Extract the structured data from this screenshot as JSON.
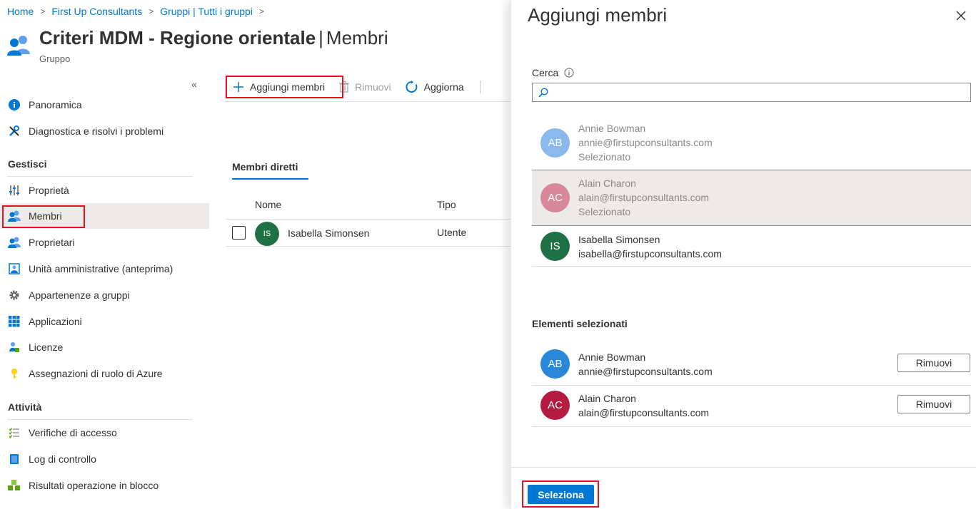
{
  "breadcrumb": [
    "Home",
    "First Up Consultants",
    "Gruppi | Tutti i gruppi"
  ],
  "header": {
    "title_main": "Criteri MDM - Regione orientale",
    "title_sep": "|",
    "title_section": "Membri",
    "subtitle": "Gruppo"
  },
  "sidebar": {
    "collapse_glyph": "«",
    "top_items": [
      {
        "label": "Panoramica",
        "icon": "info-icon"
      },
      {
        "label": "Diagnostica e risolvi i problemi",
        "icon": "wrench-icon"
      }
    ],
    "section_manage": "Gestisci",
    "manage_items": [
      {
        "label": "Proprietà",
        "icon": "sliders-icon"
      },
      {
        "label": "Membri",
        "icon": "users-icon",
        "active": true
      },
      {
        "label": "Proprietari",
        "icon": "users-icon"
      },
      {
        "label": "Unità amministrative (anteprima)",
        "icon": "admin-unit-icon"
      },
      {
        "label": "Appartenenze a gruppi",
        "icon": "gear-icon"
      },
      {
        "label": "Applicazioni",
        "icon": "grid-icon"
      },
      {
        "label": "Licenze",
        "icon": "license-icon"
      },
      {
        "label": "Assegnazioni di ruolo di Azure",
        "icon": "key-icon"
      }
    ],
    "section_activity": "Attività",
    "activity_items": [
      {
        "label": "Verifiche di accesso",
        "icon": "checklist-icon"
      },
      {
        "label": "Log di controllo",
        "icon": "book-icon"
      },
      {
        "label": "Risultati operazione in blocco",
        "icon": "cubes-icon"
      }
    ]
  },
  "toolbar": {
    "add_label": "Aggiungi membri",
    "remove_label": "Rimuovi",
    "refresh_label": "Aggiorna"
  },
  "members": {
    "tab_label": "Membri diretti",
    "columns": [
      "Nome",
      "Tipo"
    ],
    "rows": [
      {
        "initials": "IS",
        "name": "Isabella Simonsen",
        "type": "Utente"
      }
    ]
  },
  "panel": {
    "title": "Aggiungi membri",
    "search_label": "Cerca",
    "search_placeholder": "",
    "results": [
      {
        "initials": "AB",
        "name": "Annie Bowman",
        "email": "annie@firstupconsultants.com",
        "status": "Selezionato",
        "color": "#8ab8ec"
      },
      {
        "initials": "AC",
        "name": "Alain Charon",
        "email": "alain@firstupconsultants.com",
        "status": "Selezionato",
        "color": "#d9879a"
      },
      {
        "initials": "IS",
        "name": "Isabella Simonsen",
        "email": "isabella@firstupconsultants.com",
        "color": "#1e7145"
      }
    ],
    "selected_heading": "Elementi selezionati",
    "selected": [
      {
        "initials": "AB",
        "name": "Annie Bowman",
        "email": "annie@firstupconsultants.com",
        "remove_label": "Rimuovi",
        "color": "#2b88d8"
      },
      {
        "initials": "AC",
        "name": "Alain Charon",
        "email": "alain@firstupconsultants.com",
        "remove_label": "Rimuovi",
        "color": "#b31b40"
      }
    ],
    "select_button": "Seleziona"
  },
  "colors": {
    "accent": "#0078d4",
    "highlight_border": "#e81123"
  }
}
